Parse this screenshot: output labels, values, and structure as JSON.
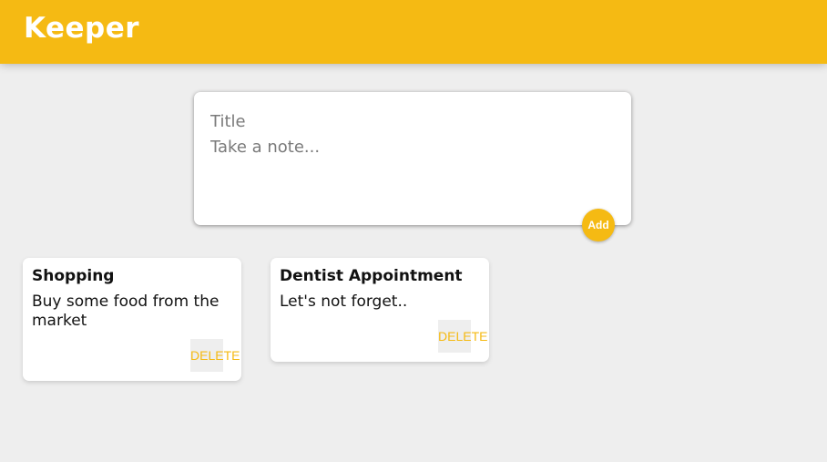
{
  "header": {
    "app_title": "Keeper"
  },
  "create_form": {
    "title_placeholder": "Title",
    "content_placeholder": "Take a note...",
    "add_label": "Add"
  },
  "notes": [
    {
      "title": "Shopping",
      "content": "Buy some food from the market",
      "delete_label": "DELETE"
    },
    {
      "title": "Dentist Appointment",
      "content": "Let's not forget..",
      "delete_label": "DELETE"
    }
  ],
  "colors": {
    "accent": "#f5ba13",
    "background": "#eeeeee",
    "card": "#ffffff"
  }
}
